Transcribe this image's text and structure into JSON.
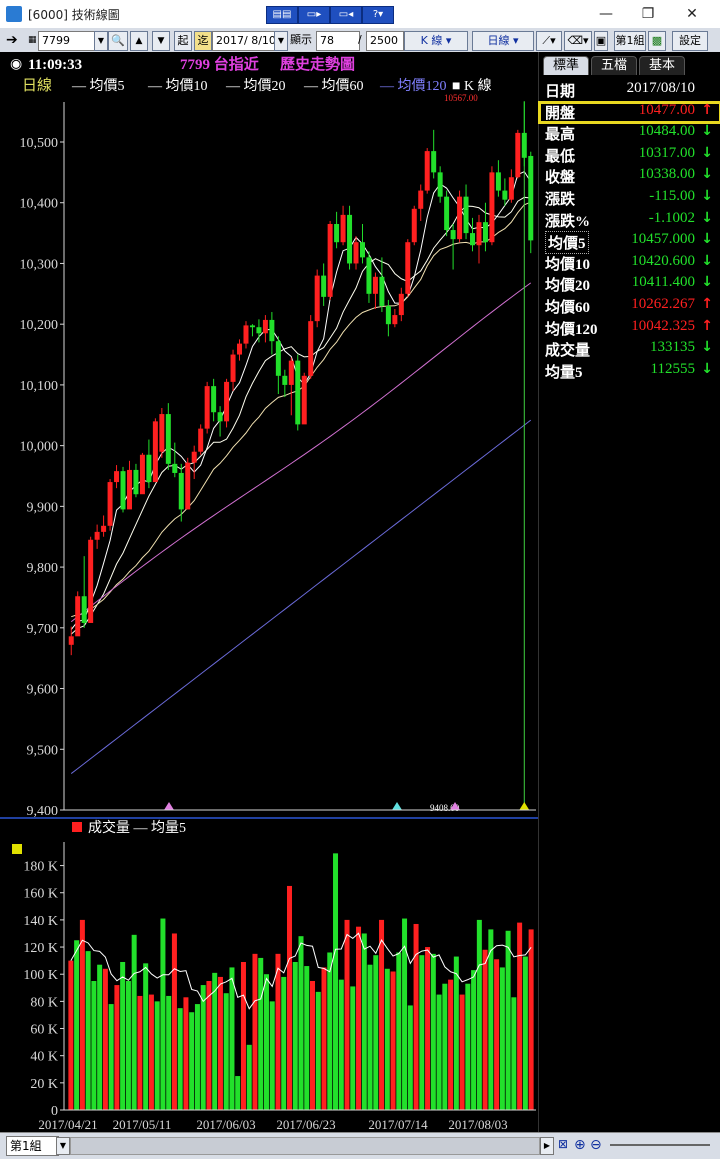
{
  "window": {
    "title": "[6000] 技術線圖",
    "min": "—",
    "max": "❐",
    "close": "✕"
  },
  "toolbar": {
    "symbol": "7799",
    "date": "2017/ 8/10",
    "display_label": "顯示",
    "display_count": "78",
    "total_label": "/",
    "total_count": "2500",
    "kline_label": "K 線 ▾",
    "period_label": "日線 ▾",
    "group_label": "第1組",
    "settings_label": "設定",
    "qi_label": "起",
    "zhe_label": "迄"
  },
  "chart": {
    "time": "11:09:33",
    "header_title": "7799 台指近",
    "header_sub": "歷史走勢圖",
    "period": "日線",
    "legend": [
      {
        "label": "均價5",
        "color": "#ffffff"
      },
      {
        "label": "均價10",
        "color": "#ffffff"
      },
      {
        "label": "均價20",
        "color": "#ffffff"
      },
      {
        "label": "均價60",
        "color": "#ffffff"
      },
      {
        "label": "均價120",
        "color": "#8080ff"
      },
      {
        "label": "K 線",
        "color": "#ffffff"
      }
    ],
    "colors": {
      "up": "#ff2020",
      "down": "#22e02b",
      "ma5": "#ffffff",
      "ma10": "#fffff0",
      "ma20": "#f0e0b0",
      "ma60": "#d070d0",
      "ma120": "#6a6ad8",
      "axis": "#d8d8d8",
      "vol_ma": "#ffffff"
    },
    "max_marker": "10567.00",
    "min_marker": "9408.00",
    "vol_legend": "成交量",
    "vol_ma_label": "均量5"
  },
  "chart_data": {
    "type": "candlestick",
    "price_ylim": [
      9400,
      10567
    ],
    "price_ticks": [
      "10,500",
      "10,400",
      "10,300",
      "10,200",
      "10,100",
      "10,000",
      "9,900",
      "9,800",
      "9,700",
      "9,600",
      "9,500",
      "9,400"
    ],
    "x_ticks": [
      "2017/04/21",
      "2017/05/11",
      "2017/06/03",
      "2017/06/23",
      "2017/07/14",
      "2017/08/03"
    ],
    "volume_ylim": [
      0,
      190000
    ],
    "volume_ticks": [
      "180 K",
      "160 K",
      "140 K",
      "120 K",
      "100 K",
      "80 K",
      "60 K",
      "40 K",
      "20 K",
      "0"
    ],
    "candles": [
      [
        9672,
        9702,
        9655,
        9686
      ],
      [
        9686,
        9760,
        9690,
        9752
      ],
      [
        9752,
        9818,
        9700,
        9708
      ],
      [
        9708,
        9850,
        9715,
        9845
      ],
      [
        9845,
        9870,
        9830,
        9858
      ],
      [
        9858,
        9885,
        9850,
        9868
      ],
      [
        9868,
        9945,
        9860,
        9940
      ],
      [
        9940,
        9968,
        9930,
        9958
      ],
      [
        9958,
        9965,
        9890,
        9895
      ],
      [
        9895,
        9975,
        9900,
        9960
      ],
      [
        9960,
        9970,
        9915,
        9920
      ],
      [
        9920,
        9988,
        9925,
        9985
      ],
      [
        9985,
        10010,
        9930,
        9940
      ],
      [
        9940,
        10045,
        9945,
        10040
      ],
      [
        9990,
        10062,
        9980,
        10052
      ],
      [
        10052,
        10070,
        9960,
        9970
      ],
      [
        9970,
        10005,
        9948,
        9955
      ],
      [
        9955,
        9970,
        9875,
        9895
      ],
      [
        9895,
        9980,
        9895,
        9972
      ],
      [
        9972,
        10000,
        9945,
        9990
      ],
      [
        9990,
        10035,
        9985,
        10028
      ],
      [
        10028,
        10105,
        10020,
        10098
      ],
      [
        10098,
        10110,
        10040,
        10055
      ],
      [
        10055,
        10065,
        10015,
        10040
      ],
      [
        10040,
        10110,
        10030,
        10105
      ],
      [
        10105,
        10158,
        10090,
        10150
      ],
      [
        10150,
        10175,
        10140,
        10168
      ],
      [
        10168,
        10205,
        10160,
        10198
      ],
      [
        10198,
        10200,
        10180,
        10195
      ],
      [
        10195,
        10208,
        10170,
        10185
      ],
      [
        10185,
        10215,
        10170,
        10207
      ],
      [
        10207,
        10220,
        10150,
        10172
      ],
      [
        10172,
        10180,
        10085,
        10115
      ],
      [
        10115,
        10125,
        10080,
        10100
      ],
      [
        10100,
        10145,
        10050,
        10140
      ],
      [
        10140,
        10150,
        10025,
        10035
      ],
      [
        10035,
        10120,
        10040,
        10115
      ],
      [
        10115,
        10215,
        10110,
        10205
      ],
      [
        10205,
        10290,
        10195,
        10280
      ],
      [
        10280,
        10300,
        10230,
        10245
      ],
      [
        10245,
        10370,
        10240,
        10365
      ],
      [
        10365,
        10385,
        10325,
        10335
      ],
      [
        10335,
        10395,
        10330,
        10380
      ],
      [
        10380,
        10395,
        10290,
        10300
      ],
      [
        10300,
        10345,
        10290,
        10335
      ],
      [
        10335,
        10365,
        10300,
        10310
      ],
      [
        10310,
        10320,
        10235,
        10250
      ],
      [
        10250,
        10285,
        10225,
        10278
      ],
      [
        10278,
        10310,
        10220,
        10230
      ],
      [
        10230,
        10240,
        10180,
        10200
      ],
      [
        10200,
        10225,
        10195,
        10215
      ],
      [
        10215,
        10260,
        10205,
        10250
      ],
      [
        10250,
        10340,
        10245,
        10335
      ],
      [
        10335,
        10395,
        10330,
        10390
      ],
      [
        10390,
        10430,
        10370,
        10420
      ],
      [
        10420,
        10490,
        10415,
        10485
      ],
      [
        10485,
        10520,
        10440,
        10450
      ],
      [
        10450,
        10460,
        10400,
        10410
      ],
      [
        10410,
        10420,
        10345,
        10355
      ],
      [
        10355,
        10365,
        10290,
        10340
      ],
      [
        10340,
        10420,
        10335,
        10410
      ],
      [
        10410,
        10430,
        10340,
        10350
      ],
      [
        10350,
        10375,
        10320,
        10330
      ],
      [
        10330,
        10380,
        10300,
        10368
      ],
      [
        10368,
        10400,
        10320,
        10335
      ],
      [
        10335,
        10460,
        10330,
        10450
      ],
      [
        10450,
        10470,
        10410,
        10420
      ],
      [
        10420,
        10440,
        10395,
        10405
      ],
      [
        10405,
        10455,
        10400,
        10442
      ],
      [
        10442,
        10520,
        10440,
        10515
      ],
      [
        10515,
        10567,
        10460,
        10474
      ],
      [
        10477,
        10484,
        10317,
        10338
      ]
    ],
    "volumes": [
      110000,
      125000,
      140000,
      117000,
      95000,
      107000,
      104000,
      78000,
      92000,
      109000,
      95000,
      129000,
      84000,
      108000,
      85000,
      80000,
      141000,
      84000,
      130000,
      75000,
      83000,
      72000,
      78000,
      92000,
      95000,
      101000,
      98000,
      86000,
      105000,
      25000,
      109000,
      48000,
      115000,
      112000,
      100000,
      80000,
      115000,
      98000,
      165000,
      109000,
      128000,
      106000,
      95000,
      87000,
      105000,
      116000,
      189000,
      96000,
      140000,
      91000,
      135000,
      130000,
      107000,
      114000,
      140000,
      104000,
      102000,
      116000,
      141000,
      77000,
      137000,
      114000,
      120000,
      115000,
      85000,
      93000,
      96000,
      113000,
      85000,
      93000,
      103000,
      140000,
      118000,
      133000,
      111000,
      105000,
      132000,
      83000,
      138000,
      113000,
      133000
    ]
  },
  "panel": {
    "tabs": [
      "標準",
      "五檔",
      "基本"
    ],
    "rows": [
      {
        "label": "日期",
        "value": "2017/08/10",
        "arrow": "",
        "label_color": "#ffffff",
        "value_color": "#ffffff"
      },
      {
        "label": "開盤",
        "value": "10477.00",
        "arrow": "↑",
        "label_color": "#ffffff",
        "value_color": "#ff2020",
        "highlight": true
      },
      {
        "label": "最高",
        "value": "10484.00",
        "arrow": "↓",
        "label_color": "#ffffff",
        "value_color": "#22e02b"
      },
      {
        "label": "最低",
        "value": "10317.00",
        "arrow": "↓",
        "label_color": "#ffffff",
        "value_color": "#22e02b"
      },
      {
        "label": "收盤",
        "value": "10338.00",
        "arrow": "↓",
        "label_color": "#ffffff",
        "value_color": "#22e02b"
      },
      {
        "label": "漲跌",
        "value": "-115.00",
        "arrow": "↓",
        "label_color": "#ffffff",
        "value_color": "#22e02b"
      },
      {
        "label": "漲跌%",
        "value": "-1.1002",
        "arrow": "↓",
        "label_color": "#ffffff",
        "value_color": "#22e02b"
      },
      {
        "label": "均價5",
        "value": "10457.000",
        "arrow": "↓",
        "label_color": "#ffffff",
        "value_color": "#22e02b",
        "boxed": true
      },
      {
        "label": "均價10",
        "value": "10420.600",
        "arrow": "↓",
        "label_color": "#ffffff",
        "value_color": "#22e02b"
      },
      {
        "label": "均價20",
        "value": "10411.400",
        "arrow": "↓",
        "label_color": "#ffffff",
        "value_color": "#22e02b"
      },
      {
        "label": "均價60",
        "value": "10262.267",
        "arrow": "↑",
        "label_color": "#ffffff",
        "value_color": "#ff2020"
      },
      {
        "label": "均價120",
        "value": "10042.325",
        "arrow": "↑",
        "label_color": "#ffffff",
        "value_color": "#ff2020"
      },
      {
        "label": "成交量",
        "value": "133135",
        "arrow": "↓",
        "label_color": "#ffffff",
        "value_color": "#22e02b"
      },
      {
        "label": "均量5",
        "value": "112555",
        "arrow": "↓",
        "label_color": "#ffffff",
        "value_color": "#22e02b"
      }
    ]
  },
  "status": {
    "group": "第1組"
  }
}
